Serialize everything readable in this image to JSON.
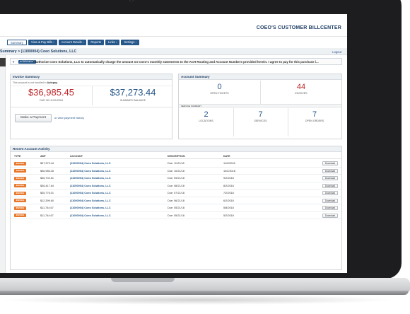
{
  "app": {
    "brand": "COEO'S CUSTOMER BILLCENTER",
    "logout": "Logout"
  },
  "tabs": [
    {
      "label": "Summary",
      "active": true
    },
    {
      "label": "View & Pay Bills ›",
      "active": false
    },
    {
      "label": "Account Details ›",
      "active": false
    },
    {
      "label": "Reports",
      "active": false
    },
    {
      "label": "Links ›",
      "active": false
    },
    {
      "label": "Settings ›",
      "active": false
    }
  ],
  "breadcrumb": "Summary > (11000004) Coeo Solutions, LLC",
  "autopay_notice": {
    "badge": "AGREEMENT",
    "message": "I authorize Coeo Solutions, LLC to automatically charge the amount on Coeo's monthly statements to the ACH Routing and Account Numbers provided herein. I agree to pay for this purchase i..."
  },
  "invoice_summary": {
    "title": "Invoice Summary",
    "note_prefix": "This account is not enrolled in",
    "note_bold": "Autopay.",
    "amount_due": "$36,985.45",
    "due_label": "DUE ON 11/21/2018",
    "summary_balance": "$37,273.44",
    "balance_label": "SUMMARY BALANCE",
    "pay_button": "Make a Payment",
    "history_link": "or view payment history"
  },
  "account_summary": {
    "title": "Account Summary",
    "open_tickets": {
      "value": "0",
      "label": "OPEN TICKETS"
    },
    "invoices": {
      "value": "44",
      "label": "INVOICES"
    },
    "service_summary_label": "SERVICE SUMMARY",
    "locations": {
      "value": "2",
      "label": "LOCATIONS"
    },
    "services": {
      "value": "7",
      "label": "SERVICES"
    },
    "open_orders": {
      "value": "7",
      "label": "OPEN ORDERS"
    }
  },
  "recent_activity": {
    "title": "Recent Account Activity",
    "columns": [
      "TYPE",
      "AMT",
      "ACCOUNT",
      "DESCRIPTION",
      "DATE"
    ],
    "download_label": "Download",
    "rows": [
      {
        "type": "INVOICE",
        "amt": "$37,373.44",
        "account": "(11000004) Coeo Solutions, LLC",
        "description": "Due: 11/21/18",
        "date": "11/2/2018"
      },
      {
        "type": "INVOICE",
        "amt": "$36,985.45",
        "account": "(11000004) Coeo Solutions, LLC",
        "description": "Due: 10/21/18",
        "date": "10/2/2018"
      },
      {
        "type": "INVOICE",
        "amt": "$36,702.51",
        "account": "(11000004) Coeo Solutions, LLC",
        "description": "Due: 09/21/18",
        "date": "9/2/2018"
      },
      {
        "type": "INVOICE",
        "amt": "$36,417.64",
        "account": "(11000004) Coeo Solutions, LLC",
        "description": "Due: 08/21/18",
        "date": "8/2/2018"
      },
      {
        "type": "INVOICE",
        "amt": "$35,776.01",
        "account": "(11000004) Coeo Solutions, LLC",
        "description": "Due: 07/21/18",
        "date": "7/2/2018"
      },
      {
        "type": "INVOICE",
        "amt": "$12,399.60",
        "account": "(11000004) Coeo Solutions, LLC",
        "description": "Due: 06/21/18",
        "date": "6/2/2018"
      },
      {
        "type": "INVOICE",
        "amt": "$11,744.67",
        "account": "(11000004) Coeo Solutions, LLC",
        "description": "Due: 05/21/18",
        "date": "5/8/2018"
      },
      {
        "type": "INVOICE",
        "amt": "$11,744.67",
        "account": "(11000004) Coeo Solutions, LLC",
        "description": "Due: 05/21/18",
        "date": "5/2/2018"
      }
    ]
  }
}
